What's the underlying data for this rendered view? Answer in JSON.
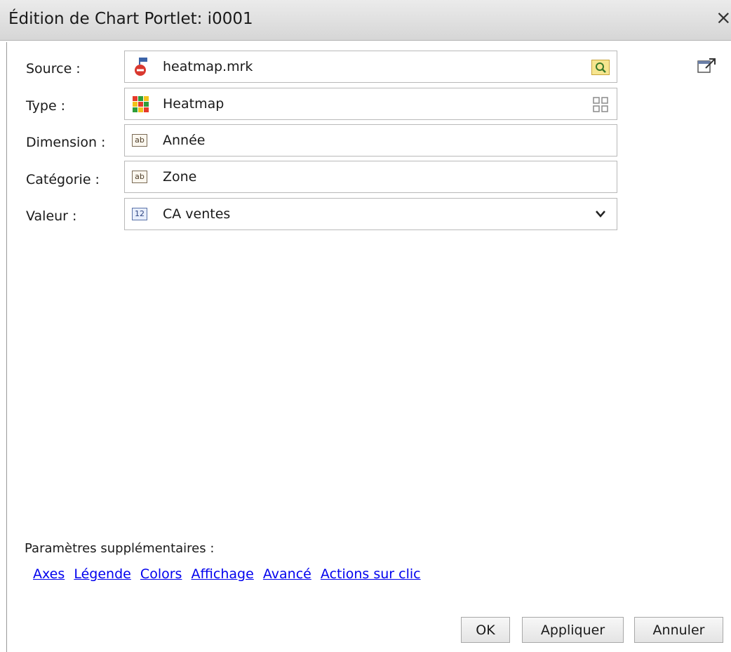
{
  "dialog": {
    "title": "Édition de Chart Portlet: i0001",
    "close_glyph": "×"
  },
  "form": {
    "source": {
      "label": "Source :",
      "value": "heatmap.mrk"
    },
    "type": {
      "label": "Type :",
      "value": "Heatmap"
    },
    "dimension": {
      "label": "Dimension :",
      "value": "Année",
      "icon_text": "ab"
    },
    "category": {
      "label": "Catégorie :",
      "value": "Zone",
      "icon_text": "ab"
    },
    "value": {
      "label": "Valeur :",
      "value": "CA ventes",
      "icon_text": "12"
    }
  },
  "params": {
    "label": "Paramètres supplémentaires :",
    "links": [
      "Axes",
      "Légende",
      "Colors",
      "Affichage",
      "Avancé",
      "Actions sur clic"
    ]
  },
  "buttons": {
    "ok": "OK",
    "apply": "Appliquer",
    "cancel": "Annuler"
  },
  "colors": {
    "link": "#0000ee",
    "titlebar": "#dcdcdc",
    "field_border": "#b9b9b9"
  }
}
